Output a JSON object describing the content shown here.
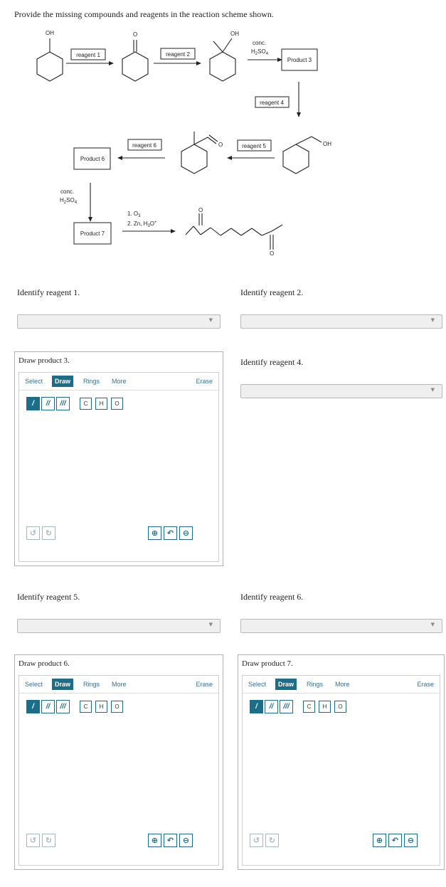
{
  "question": "Provide the missing compounds and reagents in the reaction scheme shown.",
  "scheme": {
    "oh": "OH",
    "o": "O",
    "reagent1": "reagent 1",
    "reagent2": "reagent 2",
    "conc": "conc.",
    "h2so4": "H",
    "h2so4_sub": "2",
    "h2so4_rest": "SO",
    "h2so4_sub4": "4",
    "product3": "Product 3",
    "reagent4": "reagent 4",
    "reagent5": "reagent 5",
    "reagent6": "reagent 6",
    "product6": "Product 6",
    "product7": "Product 7",
    "ozone": "1. O",
    "ozone_sub": "3",
    "zn": "2. Zn, H",
    "zn_sub": "3",
    "zn_rest": "O",
    "zn_sup": "+"
  },
  "questions": {
    "reagent1": "Identify reagent 1.",
    "reagent2": "Identify reagent 2.",
    "product3": "Draw product 3.",
    "reagent4": "Identify reagent 4.",
    "reagent5": "Identify reagent 5.",
    "reagent6": "Identify reagent 6.",
    "product6": "Draw product 6.",
    "product7": "Draw product 7."
  },
  "sketcher": {
    "tab_select": "Select",
    "tab_draw": "Draw",
    "tab_rings": "Rings",
    "tab_more": "More",
    "erase": "Erase",
    "single_bond": "/",
    "double_bond": "//",
    "triple_bond": "///",
    "atom_c": "C",
    "atom_h": "H",
    "atom_o": "O"
  },
  "colors": {
    "accent": "#1a6e8a",
    "dropdown_bg": "#efefef",
    "border": "#b0b0b0"
  },
  "icons": [
    "caret-down-icon",
    "undo-icon",
    "redo-icon",
    "zoom-in-icon",
    "reset-zoom-icon",
    "zoom-out-icon"
  ]
}
